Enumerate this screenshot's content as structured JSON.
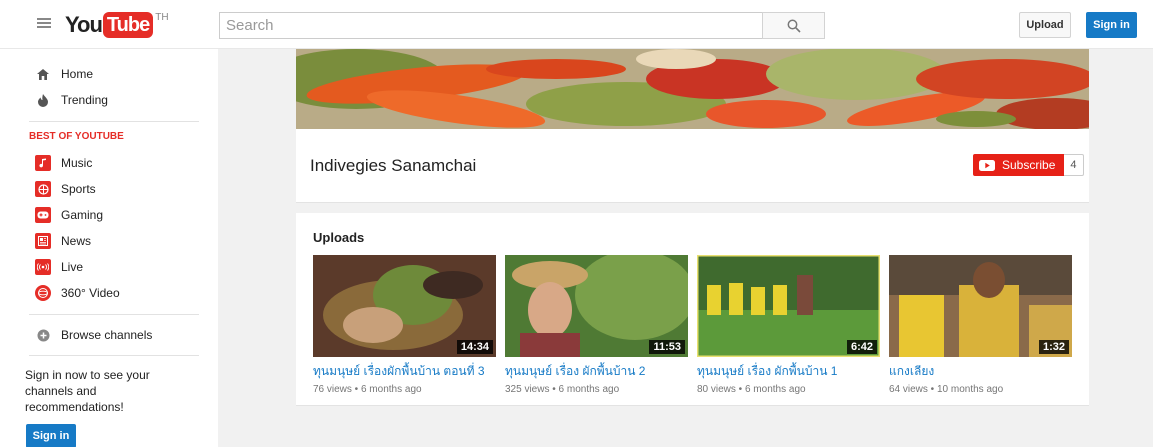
{
  "header": {
    "logo_you": "You",
    "logo_tube": "Tube",
    "logo_country": "TH",
    "search_placeholder": "Search",
    "upload_label": "Upload",
    "signin_label": "Sign in"
  },
  "sidebar": {
    "top_items": [
      {
        "label": "Home",
        "icon": "home-icon"
      },
      {
        "label": "Trending",
        "icon": "flame-icon"
      }
    ],
    "section_title": "BEST OF YOUTUBE",
    "best_items": [
      {
        "label": "Music",
        "icon": "music-icon"
      },
      {
        "label": "Sports",
        "icon": "sports-icon"
      },
      {
        "label": "Gaming",
        "icon": "gaming-icon"
      },
      {
        "label": "News",
        "icon": "news-icon"
      },
      {
        "label": "Live",
        "icon": "live-icon"
      },
      {
        "label": "360° Video",
        "icon": "360-video-icon"
      }
    ],
    "browse_label": "Browse channels",
    "signin_prompt": "Sign in now to see your channels and recommendations!",
    "signin_label": "Sign in"
  },
  "channel": {
    "name": "Indivegies Sanamchai",
    "subscribe_label": "Subscribe",
    "subscriber_count": "4"
  },
  "uploads": {
    "title": "Uploads",
    "videos": [
      {
        "title": "ทุนมนุษย์ เรื่องผักพื้นบ้าน ตอนที่ 3",
        "duration": "14:34",
        "views": "76 views",
        "age": "6 months ago"
      },
      {
        "title": "ทุนมนุษย์ เรื่อง ผักพื้นบ้าน 2",
        "duration": "11:53",
        "views": "325 views",
        "age": "6 months ago"
      },
      {
        "title": "ทุนมนุษย์ เรื่อง ผักพื้นบ้าน 1",
        "duration": "6:42",
        "views": "80 views",
        "age": "6 months ago"
      },
      {
        "title": "แกงเลียง",
        "duration": "1:32",
        "views": "64 views",
        "age": "10 months ago"
      }
    ]
  },
  "colors": {
    "brand_red": "#e52d27",
    "link_blue": "#167ac6"
  }
}
